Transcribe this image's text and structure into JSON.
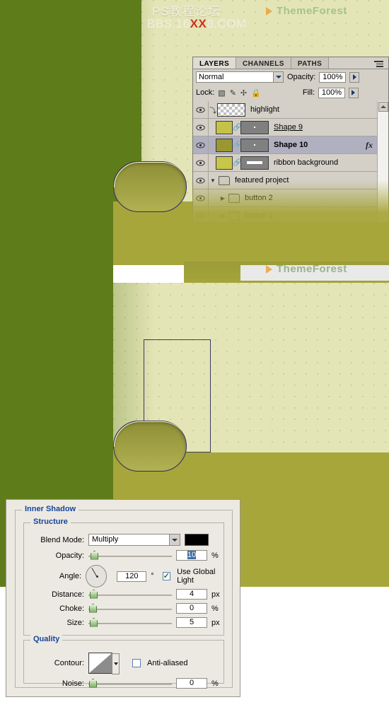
{
  "watermark": {
    "line1": "PS教程论坛",
    "line2_pre": "BBS.16",
    "line2_xx": "XX",
    "line2_post": "8.COM"
  },
  "brand": {
    "name": "ThemeForest",
    "triangle_icon": "play-triangle-icon",
    "color": "#9bbf86"
  },
  "canvas": {
    "green": "#5f7c1b",
    "cream": "#e4e5b7",
    "olive": "#a7a63b",
    "path_stroke": "#3a3a5c"
  },
  "layers_panel": {
    "tabs": [
      {
        "label": "LAYERS",
        "active": true
      },
      {
        "label": "CHANNELS",
        "active": false
      },
      {
        "label": "PATHS",
        "active": false
      }
    ],
    "menu_icon": "panel-menu-icon",
    "blend_mode": "Normal",
    "opacity_label": "Opacity:",
    "opacity_value": "100%",
    "lock_label": "Lock:",
    "lock_icons": [
      "lock-transparency-icon",
      "lock-pixels-icon",
      "lock-position-icon",
      "lock-all-icon"
    ],
    "fill_label": "Fill:",
    "fill_value": "100%",
    "layers": [
      {
        "name": "highlight",
        "thumb": "checker",
        "selected": false,
        "clipped": true,
        "fx": false,
        "type": "layer"
      },
      {
        "name": "Shape 9",
        "thumb": "color",
        "swatch": "#c5c347",
        "selected": false,
        "fx": false,
        "type": "shape",
        "underline": true
      },
      {
        "name": "Shape 10",
        "thumb": "color",
        "swatch": "#9a9730",
        "selected": true,
        "fx": true,
        "type": "shape",
        "bold": true
      },
      {
        "name": "ribbon background",
        "thumb": "color",
        "swatch": "#c7c64b",
        "selected": false,
        "fx": false,
        "type": "shape"
      },
      {
        "name": "featured project",
        "thumb": "folder",
        "selected": false,
        "expanded": true,
        "type": "group"
      },
      {
        "name": "button 2",
        "thumb": "folder",
        "selected": false,
        "expanded": false,
        "type": "group",
        "indent": true
      },
      {
        "name": "button 1",
        "thumb": "folder",
        "selected": false,
        "expanded": false,
        "type": "group",
        "indent": true
      }
    ],
    "fx_label": "fx",
    "scroll_up_icon": "scroll-up-arrow-icon"
  },
  "inner_shadow_dialog": {
    "title": "Inner Shadow",
    "structure_title": "Structure",
    "quality_title": "Quality",
    "blend_mode_label": "Blend Mode:",
    "blend_mode_value": "Multiply",
    "color_swatch": "#000000",
    "opacity_label": "Opacity:",
    "opacity_value": "10",
    "opacity_unit": "%",
    "angle_label": "Angle:",
    "angle_value": "120",
    "angle_unit": "°",
    "global_light_label": "Use Global Light",
    "global_light_checked": true,
    "distance_label": "Distance:",
    "distance_value": "4",
    "distance_unit": "px",
    "choke_label": "Choke:",
    "choke_value": "0",
    "choke_unit": "%",
    "size_label": "Size:",
    "size_value": "5",
    "size_unit": "px",
    "contour_label": "Contour:",
    "anti_aliased_label": "Anti-aliased",
    "anti_aliased_checked": false,
    "noise_label": "Noise:",
    "noise_value": "0",
    "noise_unit": "%",
    "heading_color": "#15469b"
  }
}
